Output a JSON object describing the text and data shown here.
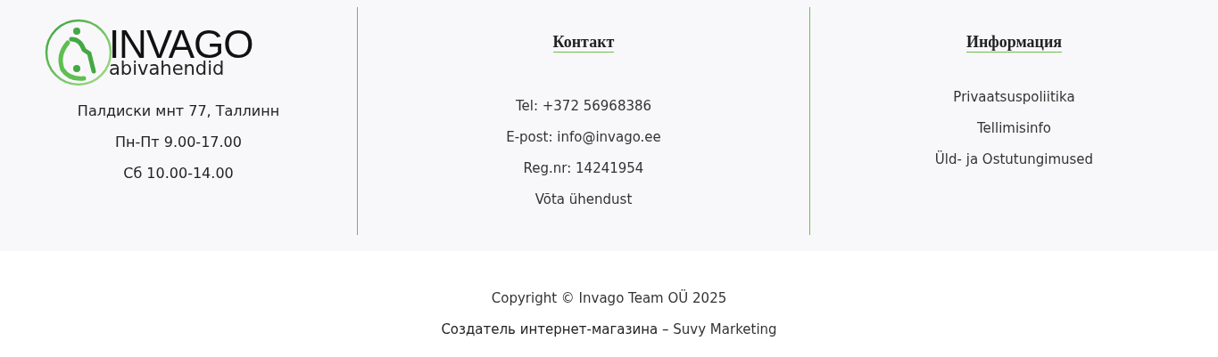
{
  "logo": {
    "name": "INVAGO",
    "tagline": "abivahendid"
  },
  "address": [
    "Палдиски мнт 77, Таллинн",
    "Пн-Пт 9.00-17.00",
    "Сб 10.00-14.00"
  ],
  "contact": {
    "title": "Контакт",
    "lines": [
      "Tel: +372 56968386",
      "E-post: info@invago.ee",
      "Reg.nr: 14241954",
      "Võta ühendust"
    ]
  },
  "info": {
    "title": "Информация",
    "links": [
      "Privaatsuspoliitika",
      "Tellimisinfo",
      "Üld- ja Ostutungimused"
    ]
  },
  "footer": {
    "copyright": "Copyright © Invago Team OÜ 2025",
    "credit": "Создатель интернет-магазина – ",
    "credit_link": "Suvy Marketing"
  }
}
